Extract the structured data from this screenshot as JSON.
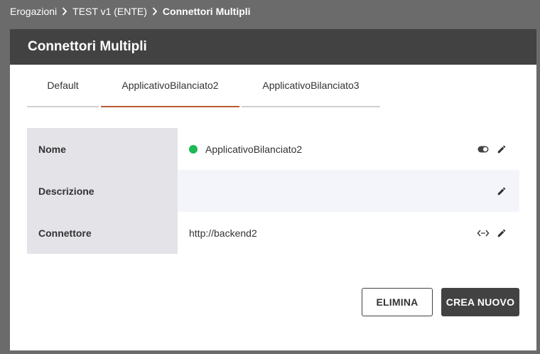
{
  "breadcrumb": {
    "items": [
      {
        "label": "Erogazioni"
      },
      {
        "label": "TEST v1 (ENTE)"
      },
      {
        "label": "Connettori Multipli"
      }
    ]
  },
  "card": {
    "title": "Connettori Multipli"
  },
  "tabs": [
    {
      "label": "Default",
      "active": false
    },
    {
      "label": "ApplicativoBilanciato2",
      "active": true
    },
    {
      "label": "ApplicativoBilanciato3",
      "active": false
    }
  ],
  "details": {
    "rows": [
      {
        "label": "Nome",
        "value": "ApplicativoBilanciato2",
        "status": "enabled",
        "icons": [
          "toggle-icon",
          "edit-icon"
        ]
      },
      {
        "label": "Descrizione",
        "value": "",
        "icons": [
          "edit-icon"
        ]
      },
      {
        "label": "Connettore",
        "value": "http://backend2",
        "icons": [
          "code-icon",
          "edit-icon"
        ]
      }
    ]
  },
  "buttons": {
    "delete_label": "ELIMINA",
    "create_label": "CREA NUOVO"
  },
  "colors": {
    "header_bg": "#424242",
    "active_tab": "#b65c36",
    "status_green": "#1db954",
    "label_bg": "#e3e3e8"
  }
}
